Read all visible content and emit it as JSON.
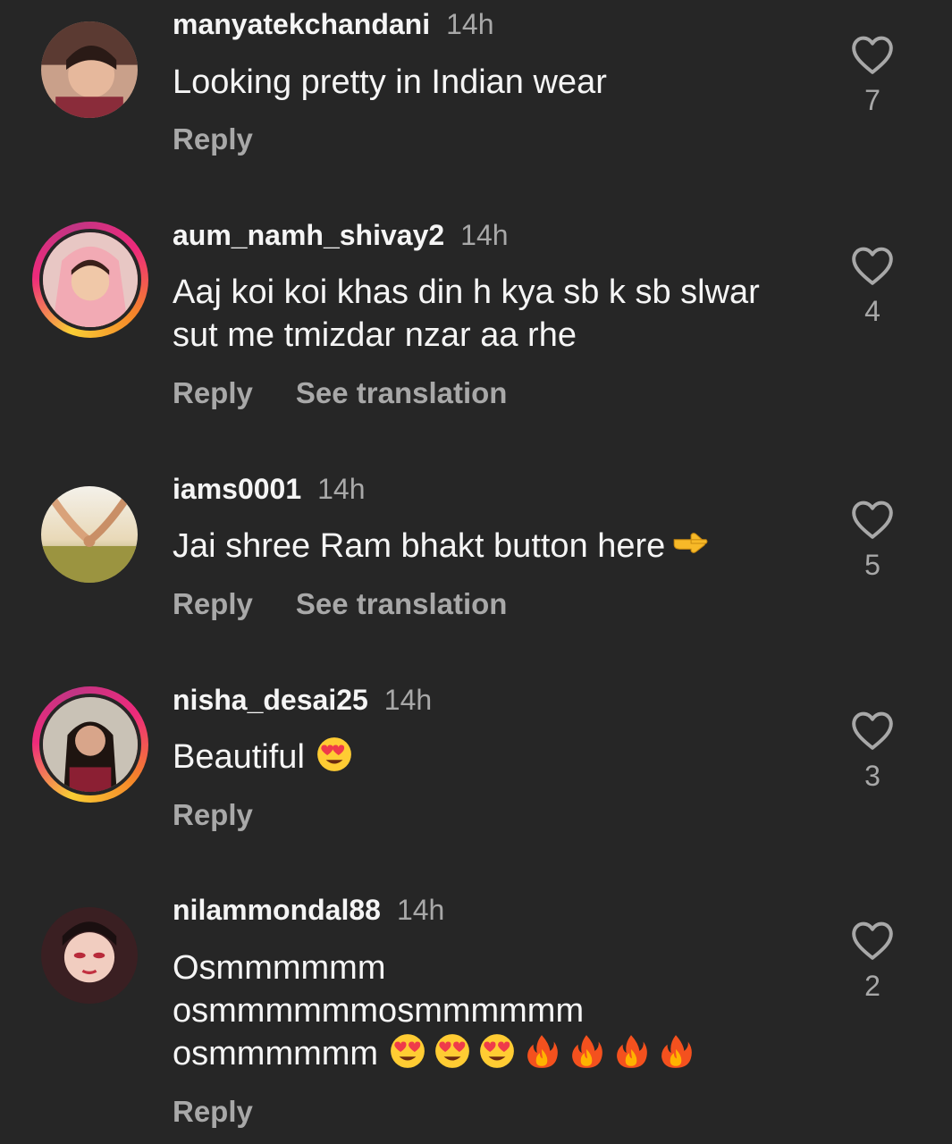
{
  "comments": [
    {
      "username": "manyatekchandani",
      "time": "14h",
      "text": "Looking pretty in Indian wear",
      "reply_label": "Reply",
      "likes": "7"
    },
    {
      "username": "aum_namh_shivay2",
      "time": "14h",
      "text_line1": "Aaj koi koi khas din h kya sb k sb slwar",
      "text_line2": "sut me tmizdar nzar aa rhe",
      "reply_label": "Reply",
      "translate_label": "See translation",
      "likes": "4"
    },
    {
      "username": "iams0001",
      "time": "14h",
      "text": "Jai shree Ram bhakt button here",
      "emoji": "pointing-right-emoji",
      "reply_label": "Reply",
      "translate_label": "See translation",
      "likes": "5"
    },
    {
      "username": "nisha_desai25",
      "time": "14h",
      "text": "Beautiful",
      "emoji": "heart-eyes-emoji",
      "reply_label": "Reply",
      "likes": "3"
    },
    {
      "username": "nilammondal88",
      "time": "14h",
      "text_line1": "Osmmmmmm",
      "text_line2": "osmmmmmmosmmmmmm",
      "text_line3": "osmmmmmm",
      "emojis": [
        "heart-eyes-emoji",
        "heart-eyes-emoji",
        "heart-eyes-emoji",
        "fire-emoji",
        "fire-emoji",
        "fire-emoji",
        "fire-emoji"
      ],
      "reply_label": "Reply",
      "likes": "2"
    }
  ],
  "colors": {
    "background": "#262626",
    "primary_text": "#f5f5f5",
    "secondary_text": "#a8a8a8",
    "story_ring": "#ee2a7b"
  },
  "icons": {
    "like": "heart-outline-icon"
  }
}
